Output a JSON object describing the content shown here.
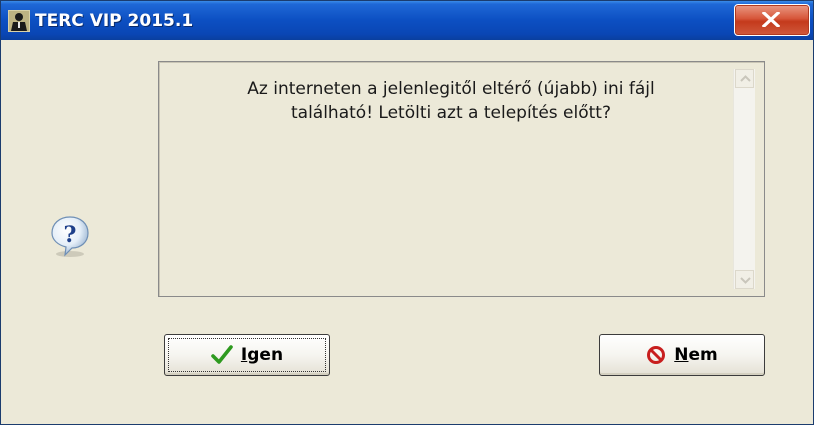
{
  "window": {
    "title": "TERC VIP 2015.1",
    "icons": {
      "app": "app-person-icon",
      "close": "close-x-icon"
    }
  },
  "dialog": {
    "icon": "question-icon",
    "message_line1": "Az interneten a jelenlegitől eltérő (újabb) ini fájl",
    "message_line2": "található! Letölti azt a telepítés előtt?",
    "scrollbar": {
      "up": "scroll-up-arrow-icon",
      "down": "scroll-down-arrow-icon"
    }
  },
  "buttons": {
    "yes": {
      "label_first": "I",
      "label_rest": "gen",
      "icon": "checkmark-icon",
      "icon_color": "#2e9a1f"
    },
    "no": {
      "label_first": "N",
      "label_rest": "em",
      "icon": "no-entry-icon",
      "icon_color": "#c81e1e"
    }
  }
}
